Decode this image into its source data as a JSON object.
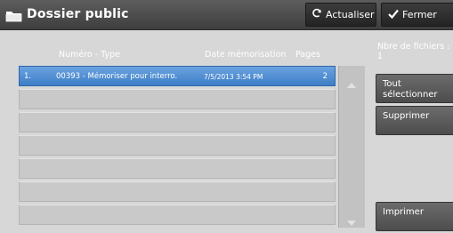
{
  "header": {
    "title": "Dossier public",
    "refresh_label": "Actualiser",
    "close_label": "Fermer"
  },
  "columns": {
    "number_type": "Numéro - Type",
    "date": "Date mémorisation",
    "pages": "Pages"
  },
  "rows": [
    {
      "index": "1.",
      "name": "00393 - Mémoriser pour interro.",
      "date": "7/5/2013 3:54 PM",
      "pages": "2",
      "selected": true
    }
  ],
  "empty_rows": 6,
  "side": {
    "file_count_label": "Nbre de fichiers :",
    "file_count_value": "1",
    "select_all": "Tout sélectionner",
    "delete": "Supprimer",
    "print": "Imprimer"
  },
  "icons": {
    "title": "folder-icon",
    "refresh": "refresh-icon",
    "close": "checkmark-icon",
    "scroll_up": "arrow-up-icon",
    "scroll_down": "arrow-down-icon"
  }
}
